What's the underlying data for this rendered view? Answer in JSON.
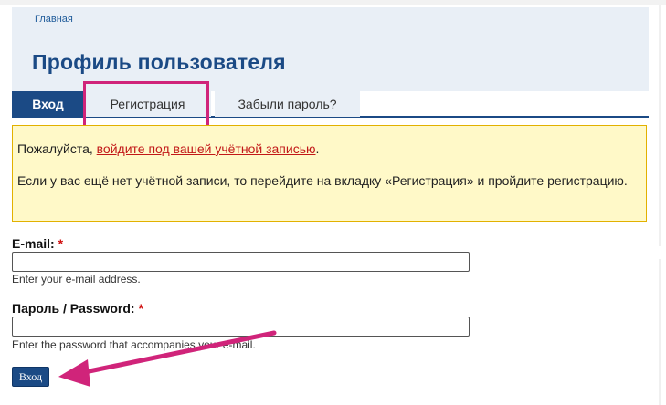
{
  "breadcrumb": {
    "home": "Главная"
  },
  "page": {
    "title": "Профиль пользователя"
  },
  "tabs": [
    {
      "label": "Вход",
      "active": true
    },
    {
      "label": "Регистрация",
      "active": false
    },
    {
      "label": "Забыли пароль?",
      "active": false
    }
  ],
  "notice": {
    "line1_prefix": "Пожалуйста, ",
    "line1_link": "войдите под вашей учётной записью",
    "line1_suffix": ".",
    "line2": "Если у вас ещё нет учётной записи, то перейдите на вкладку «Регистрация» и пройдите регистрацию."
  },
  "form": {
    "email": {
      "label": "E-mail:",
      "required_mark": "*",
      "value": "",
      "description": "Enter your e-mail address."
    },
    "password": {
      "label": "Пароль / Password:",
      "required_mark": "*",
      "value": "",
      "description": "Enter the password that accompanies your e-mail."
    },
    "submit_label": "Вход"
  },
  "colors": {
    "accent": "#1b4a85",
    "header_bg": "#e9eff6",
    "notice_bg": "#fff9c8",
    "notice_border": "#e2b100",
    "annotation": "#d0247a",
    "link": "#c21818"
  },
  "annotations": {
    "highlight": "tab-register",
    "arrow_target": "submit-button"
  }
}
